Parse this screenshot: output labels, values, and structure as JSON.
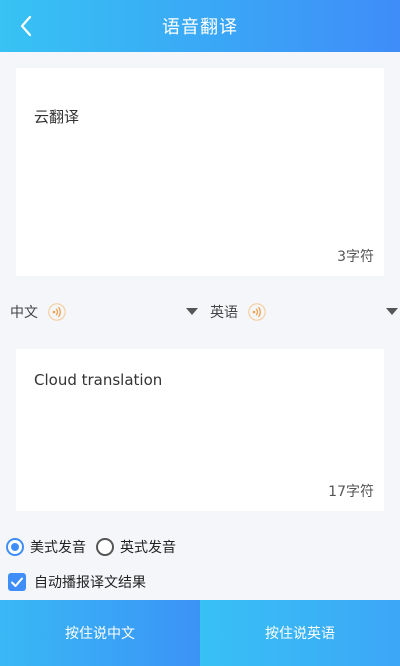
{
  "header": {
    "title": "语音翻译",
    "back_icon": "chevron-left-icon"
  },
  "source": {
    "text": "云翻译",
    "char_count": "3字符"
  },
  "languages": {
    "source_label": "中文",
    "target_label": "英语",
    "speaker_icon": "speaker-icon",
    "dropdown_icon": "caret-down-icon"
  },
  "target": {
    "text": "Cloud translation",
    "char_count": "17字符"
  },
  "pronunciation": {
    "options": [
      "美式发音",
      "英式发音"
    ],
    "selected": "美式发音"
  },
  "auto_play": {
    "label": "自动播报译文结果",
    "checked": true
  },
  "buttons": {
    "speak_chinese": "按住说中文",
    "speak_english": "按住说英语"
  },
  "colors": {
    "accent": "#3f8ef7",
    "header_start": "#37c3f3",
    "header_end": "#3f8df8",
    "speaker_orange": "#f0a04b"
  }
}
